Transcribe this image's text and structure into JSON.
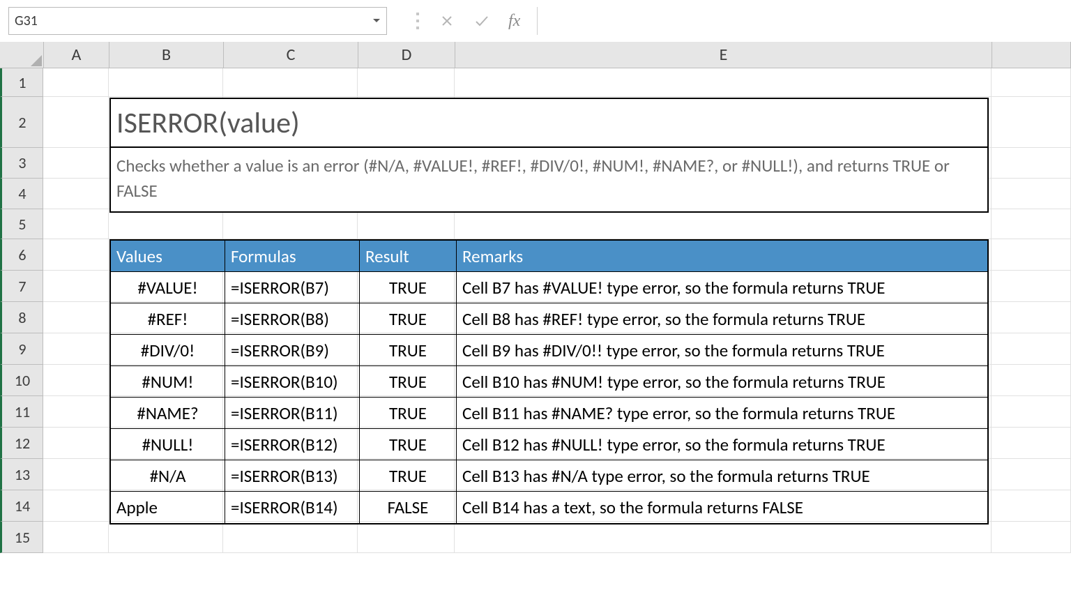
{
  "nameBox": "G31",
  "formulaValue": "",
  "fxLabel": "fx",
  "columns": [
    "A",
    "B",
    "C",
    "D",
    "E"
  ],
  "rowNumbers": [
    1,
    2,
    3,
    4,
    5,
    6,
    7,
    8,
    9,
    10,
    11,
    12,
    13,
    14,
    15
  ],
  "title": "ISERROR(value)",
  "description": "Checks whether a value is an error (#N/A, #VALUE!, #REF!, #DIV/0!, #NUM!, #NAME?, or #NULL!), and returns TRUE or FALSE",
  "table": {
    "headers": {
      "values": "Values",
      "formulas": "Formulas",
      "result": "Result",
      "remarks": "Remarks"
    },
    "rows": [
      {
        "value": "#VALUE!",
        "formula": "=ISERROR(B7)",
        "result": "TRUE",
        "remark": "Cell B7 has #VALUE! type error, so the formula returns TRUE",
        "valAlign": "center"
      },
      {
        "value": "#REF!",
        "formula": "=ISERROR(B8)",
        "result": "TRUE",
        "remark": "Cell B8 has #REF! type error, so the formula returns TRUE",
        "valAlign": "center"
      },
      {
        "value": "#DIV/0!",
        "formula": "=ISERROR(B9)",
        "result": "TRUE",
        "remark": "Cell B9 has #DIV/0!! type error, so the formula returns TRUE",
        "valAlign": "center"
      },
      {
        "value": "#NUM!",
        "formula": "=ISERROR(B10)",
        "result": "TRUE",
        "remark": "Cell B10 has #NUM! type error, so the formula returns TRUE",
        "valAlign": "center"
      },
      {
        "value": "#NAME?",
        "formula": "=ISERROR(B11)",
        "result": "TRUE",
        "remark": "Cell B11 has #NAME? type error, so the formula returns TRUE",
        "valAlign": "center"
      },
      {
        "value": "#NULL!",
        "formula": "=ISERROR(B12)",
        "result": "TRUE",
        "remark": "Cell B12 has #NULL! type error, so the formula returns TRUE",
        "valAlign": "center"
      },
      {
        "value": "#N/A",
        "formula": "=ISERROR(B13)",
        "result": "TRUE",
        "remark": "Cell B13 has #N/A type error, so the formula returns TRUE",
        "valAlign": "center"
      },
      {
        "value": "Apple",
        "formula": "=ISERROR(B14)",
        "result": "FALSE",
        "remark": "Cell B14 has a text, so the formula returns FALSE",
        "valAlign": "left"
      }
    ]
  }
}
